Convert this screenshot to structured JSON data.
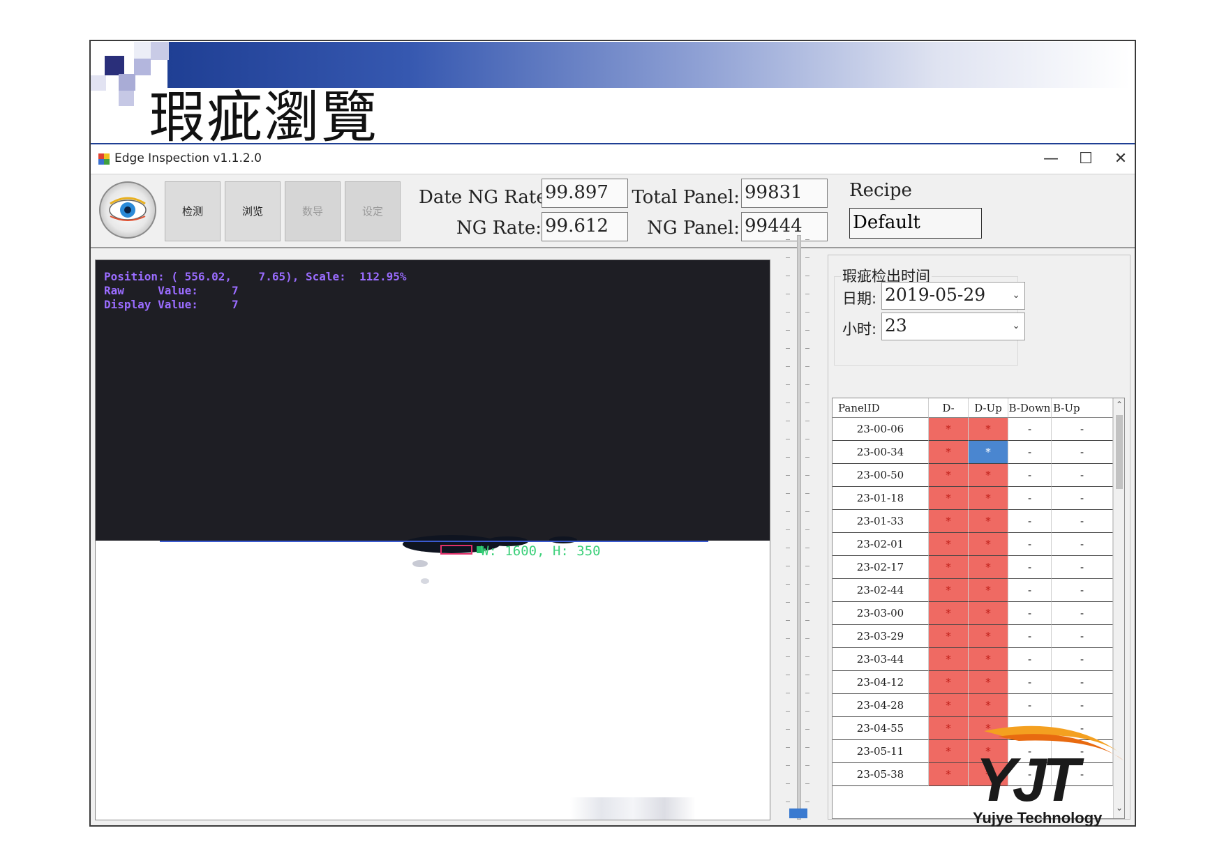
{
  "slide": {
    "title": "瑕疵瀏覽",
    "brand_text": "Yujye Technology",
    "brand_logo_letters": "YJT"
  },
  "window": {
    "title": "Edge Inspection  v1.1.2.0",
    "minimize_glyph": "—",
    "maximize_glyph": "☐",
    "close_glyph": "✕"
  },
  "toolbar": {
    "buttons": [
      {
        "label": "检测",
        "enabled": true
      },
      {
        "label": "浏览",
        "enabled": true
      },
      {
        "label": "数导",
        "enabled": false
      },
      {
        "label": "设定",
        "enabled": false
      }
    ],
    "date_ng_rate_label": "Date NG Rate:",
    "date_ng_rate_value": "99.897",
    "ng_rate_label": "NG Rate:",
    "ng_rate_value": "99.612",
    "total_panel_label": "Total Panel:",
    "total_panel_value": "99831",
    "ng_panel_label": "NG Panel:",
    "ng_panel_value": "99444",
    "recipe_label": "Recipe",
    "recipe_value": "Default"
  },
  "viewer": {
    "overlay_line1": "Position: ( 556.02,    7.65), Scale:  112.95%",
    "overlay_line2": "Raw     Value:     7",
    "overlay_line3": "Display Value:     7",
    "defect_info": "W: 1600, H: 350"
  },
  "time_filter": {
    "group_title": "瑕疵检出时间",
    "date_label": "日期:",
    "date_value": "2019-05-29",
    "hour_label": "小时:",
    "hour_value": "23",
    "dropdown_glyph": "⌄"
  },
  "table": {
    "columns": [
      "PanelID",
      "D-Down",
      "D-Up",
      "B-Down",
      "B-Up"
    ],
    "rows": [
      {
        "id": "23-00-06",
        "d_down": "*",
        "d_up": "*",
        "b_down": "-",
        "b_up": "-"
      },
      {
        "id": "23-00-34",
        "d_down": "*",
        "d_up": "*",
        "b_down": "-",
        "b_up": "-"
      },
      {
        "id": "23-00-50",
        "d_down": "*",
        "d_up": "*",
        "b_down": "-",
        "b_up": "-"
      },
      {
        "id": "23-01-18",
        "d_down": "*",
        "d_up": "*",
        "b_down": "-",
        "b_up": "-"
      },
      {
        "id": "23-01-33",
        "d_down": "*",
        "d_up": "*",
        "b_down": "-",
        "b_up": "-"
      },
      {
        "id": "23-02-01",
        "d_down": "*",
        "d_up": "*",
        "b_down": "-",
        "b_up": "-"
      },
      {
        "id": "23-02-17",
        "d_down": "*",
        "d_up": "*",
        "b_down": "-",
        "b_up": "-"
      },
      {
        "id": "23-02-44",
        "d_down": "*",
        "d_up": "*",
        "b_down": "-",
        "b_up": "-"
      },
      {
        "id": "23-03-00",
        "d_down": "*",
        "d_up": "*",
        "b_down": "-",
        "b_up": "-"
      },
      {
        "id": "23-03-29",
        "d_down": "*",
        "d_up": "*",
        "b_down": "-",
        "b_up": "-"
      },
      {
        "id": "23-03-44",
        "d_down": "*",
        "d_up": "*",
        "b_down": "-",
        "b_up": "-"
      },
      {
        "id": "23-04-12",
        "d_down": "*",
        "d_up": "*",
        "b_down": "-",
        "b_up": "-"
      },
      {
        "id": "23-04-28",
        "d_down": "*",
        "d_up": "*",
        "b_down": "-",
        "b_up": "-"
      },
      {
        "id": "23-04-55",
        "d_down": "*",
        "d_up": "*",
        "b_down": "-",
        "b_up": "-"
      },
      {
        "id": "23-05-11",
        "d_down": "*",
        "d_up": "*",
        "b_down": "-",
        "b_up": "-"
      },
      {
        "id": "23-05-38",
        "d_down": "*",
        "d_up": "*",
        "b_down": "-",
        "b_up": "-"
      }
    ],
    "selected_row": 1,
    "selected_column": "d_up",
    "ng_color": "#ef6a63",
    "selected_color": "#4a86d0",
    "scroll_up_glyph": "⌃",
    "scroll_down_glyph": "⌄"
  },
  "colors": {
    "header_band_start": "#1f3f94",
    "slider_thumb": "#3a7ad0",
    "overlay_text": "#9a6cff",
    "defect_box": "#e0306a",
    "defect_text": "#3cd07a"
  }
}
